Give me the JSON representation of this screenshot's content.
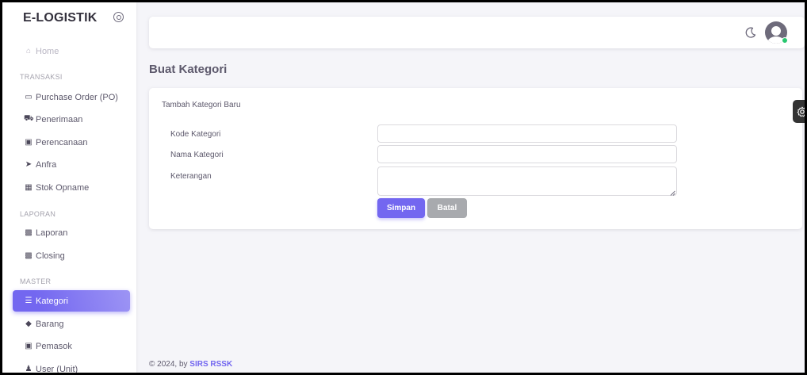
{
  "sidebar": {
    "brand": "E-LOGISTIK",
    "home": "Home",
    "sections": {
      "transaksi": "TRANSAKSI",
      "laporan": "LAPORAN",
      "master": "MASTER"
    },
    "items": {
      "purchase_order": "Purchase Order (PO)",
      "penerimaan": "Penerimaan",
      "perencanaan": "Perencanaan",
      "anfra": "Anfra",
      "stok_opname": "Stok Opname",
      "laporan": "Laporan",
      "closing": "Closing",
      "kategori": "Kategori",
      "barang": "Barang",
      "pemasok": "Pemasok",
      "user_unit": "User (Unit)"
    },
    "active_item": "Kategori"
  },
  "page": {
    "title": "Buat Kategori"
  },
  "form": {
    "card_title": "Tambah Kategori Baru",
    "kode_label": "Kode Kategori",
    "kode_value": "",
    "nama_label": "Nama Kategori",
    "nama_value": "",
    "keterangan_label": "Keterangan",
    "keterangan_value": "",
    "save_label": "Simpan",
    "cancel_label": "Batal"
  },
  "footer": {
    "prefix": "© 2024, by ",
    "link": "SIRS RSSK"
  },
  "icons": {
    "brand_toggle": "radio-circle-icon",
    "theme": "moon-icon",
    "settings": "gear-icon"
  },
  "colors": {
    "primary": "#7367f0",
    "secondary": "#a8aaae",
    "online": "#28c76f"
  }
}
